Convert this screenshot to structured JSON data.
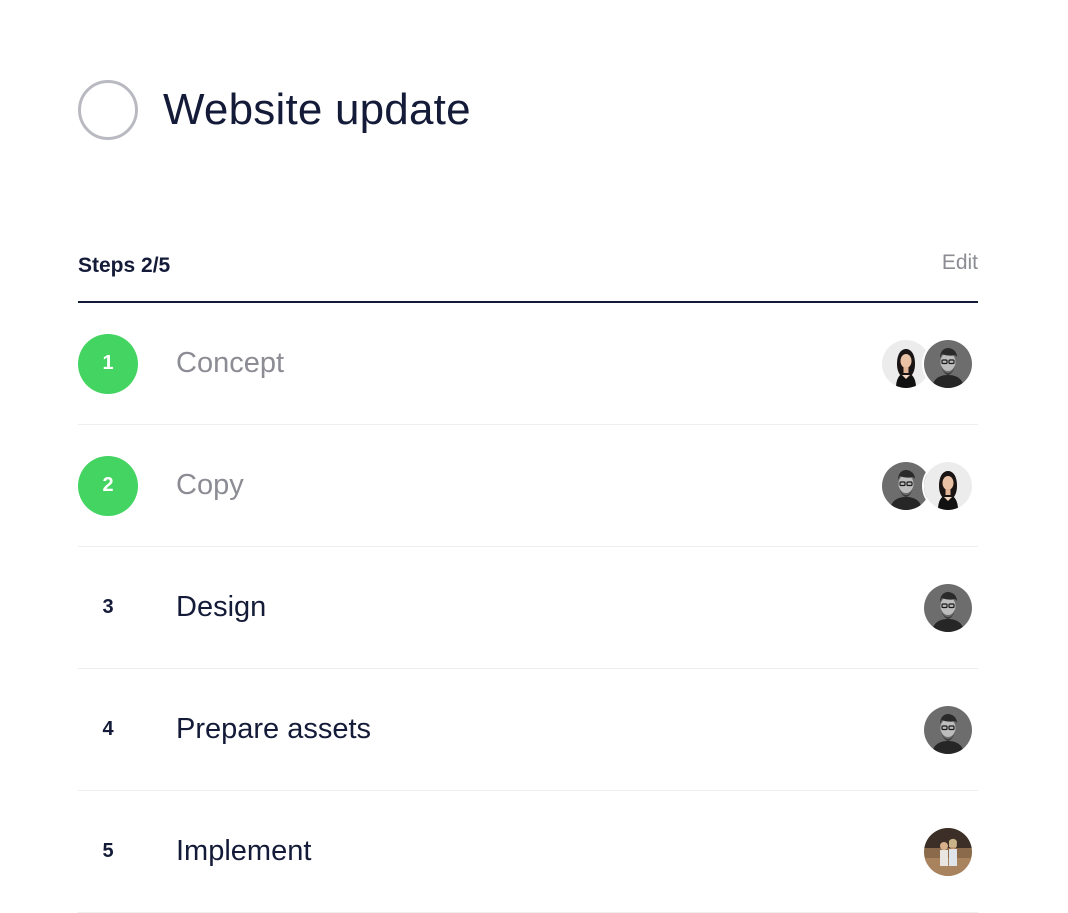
{
  "task": {
    "title": "Website update"
  },
  "steps": {
    "label": "Steps 2/5",
    "edit_label": "Edit",
    "items": [
      {
        "number": "1",
        "name": "Concept",
        "done": true,
        "assignees": [
          "woman-avatar",
          "man-avatar"
        ]
      },
      {
        "number": "2",
        "name": "Copy",
        "done": true,
        "assignees": [
          "man-avatar",
          "woman-avatar"
        ]
      },
      {
        "number": "3",
        "name": "Design",
        "done": false,
        "assignees": [
          "man-avatar"
        ]
      },
      {
        "number": "4",
        "name": "Prepare assets",
        "done": false,
        "assignees": [
          "man-avatar"
        ]
      },
      {
        "number": "5",
        "name": "Implement",
        "done": false,
        "assignees": [
          "couple-avatar"
        ]
      }
    ]
  },
  "colors": {
    "done_green": "#44d462",
    "text_dark": "#141b38",
    "text_muted": "#8c8d94",
    "toggle_border": "#b9bac1"
  }
}
